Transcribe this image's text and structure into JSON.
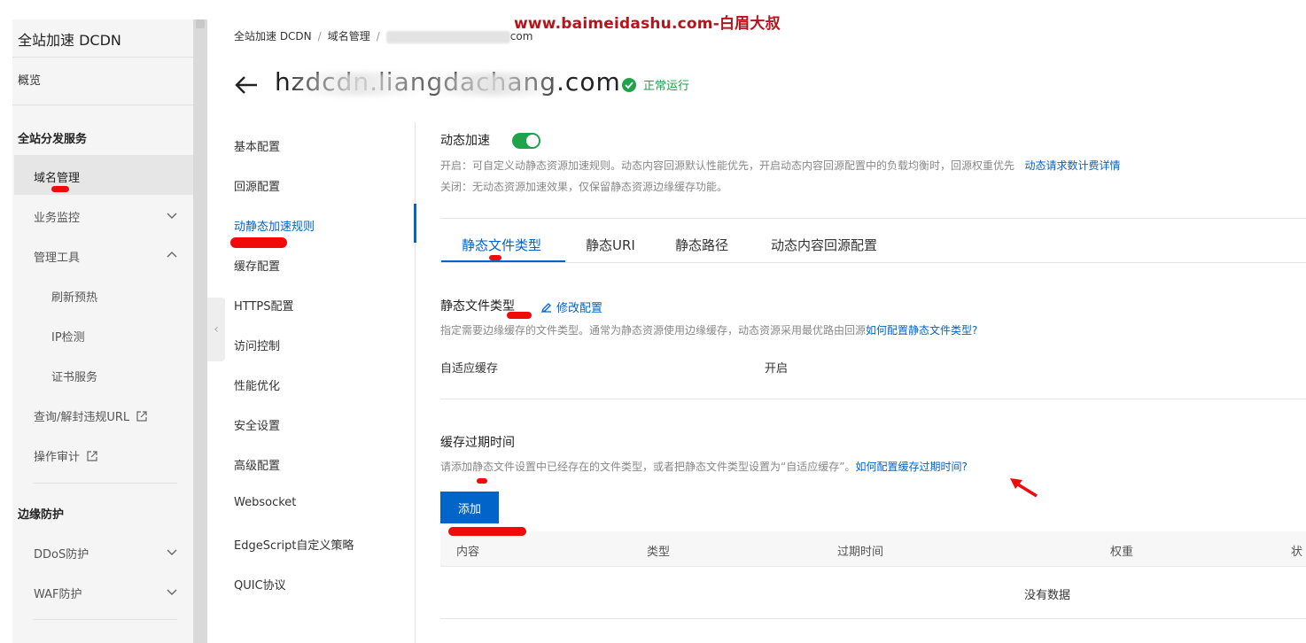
{
  "watermark": "www.baimeidashu.com-白眉大叔",
  "sidebar": {
    "title": "全站加速 DCDN",
    "overview": "概览",
    "sections": {
      "distribution": "全站分发服务",
      "edge": "边缘防护"
    },
    "items": {
      "domain_mgmt": "域名管理",
      "monitoring": "业务监控",
      "tools": "管理工具",
      "refresh": "刷新预热",
      "ip_check": "IP检测",
      "cert": "证书服务",
      "query_url": "查询/解封违规URL",
      "audit": "操作审计",
      "ddos": "DDoS防护",
      "waf": "WAF防护"
    }
  },
  "header": {
    "breadcrumb": [
      "全站加速 DCDN",
      "域名管理"
    ],
    "breadcrumb_tail": "com",
    "title": "hzdcdn.liangdachang.com",
    "status": "正常运行"
  },
  "menu": [
    "基本配置",
    "回源配置",
    "动静态加速规则",
    "缓存配置",
    "HTTPS配置",
    "访问控制",
    "性能优化",
    "安全设置",
    "高级配置",
    "Websocket",
    "EdgeScript自定义策略",
    "QUIC协议"
  ],
  "dynamic": {
    "label": "动态加速",
    "enabled": true,
    "desc_on": "开启：可自定义动静态资源加速规则。动态内容回源默认性能优先，开启动态内容回源配置中的负载均衡时，回源权重优先",
    "desc_on_link": "动态请求数计费详情",
    "desc_off": "关闭：无动态资源加速效果，仅保留静态资源边缘缓存功能。"
  },
  "tabs": [
    "静态文件类型",
    "静态URI",
    "静态路径",
    "动态内容回源配置"
  ],
  "static_type": {
    "title": "静态文件类型",
    "edit": "修改配置",
    "desc": "指定需要边缘缓存的文件类型。通常为静态资源使用边缘缓存，动态资源采用最优路由回源",
    "desc_link": "如何配置静态文件类型?",
    "key": "自适应缓存",
    "value": "开启"
  },
  "cache_expire": {
    "title": "缓存过期时间",
    "desc": "请添加静态文件设置中已经存在的文件类型，或者把静态文件类型设置为“自适应缓存”。",
    "desc_link": "如何配置缓存过期时间?",
    "add": "添加",
    "columns": [
      "内容",
      "类型",
      "过期时间",
      "权重",
      "状"
    ],
    "empty": "没有数据"
  },
  "colors": {
    "accent": "#0064c8",
    "success": "#1ea34a",
    "markup": "#f00a0a"
  }
}
